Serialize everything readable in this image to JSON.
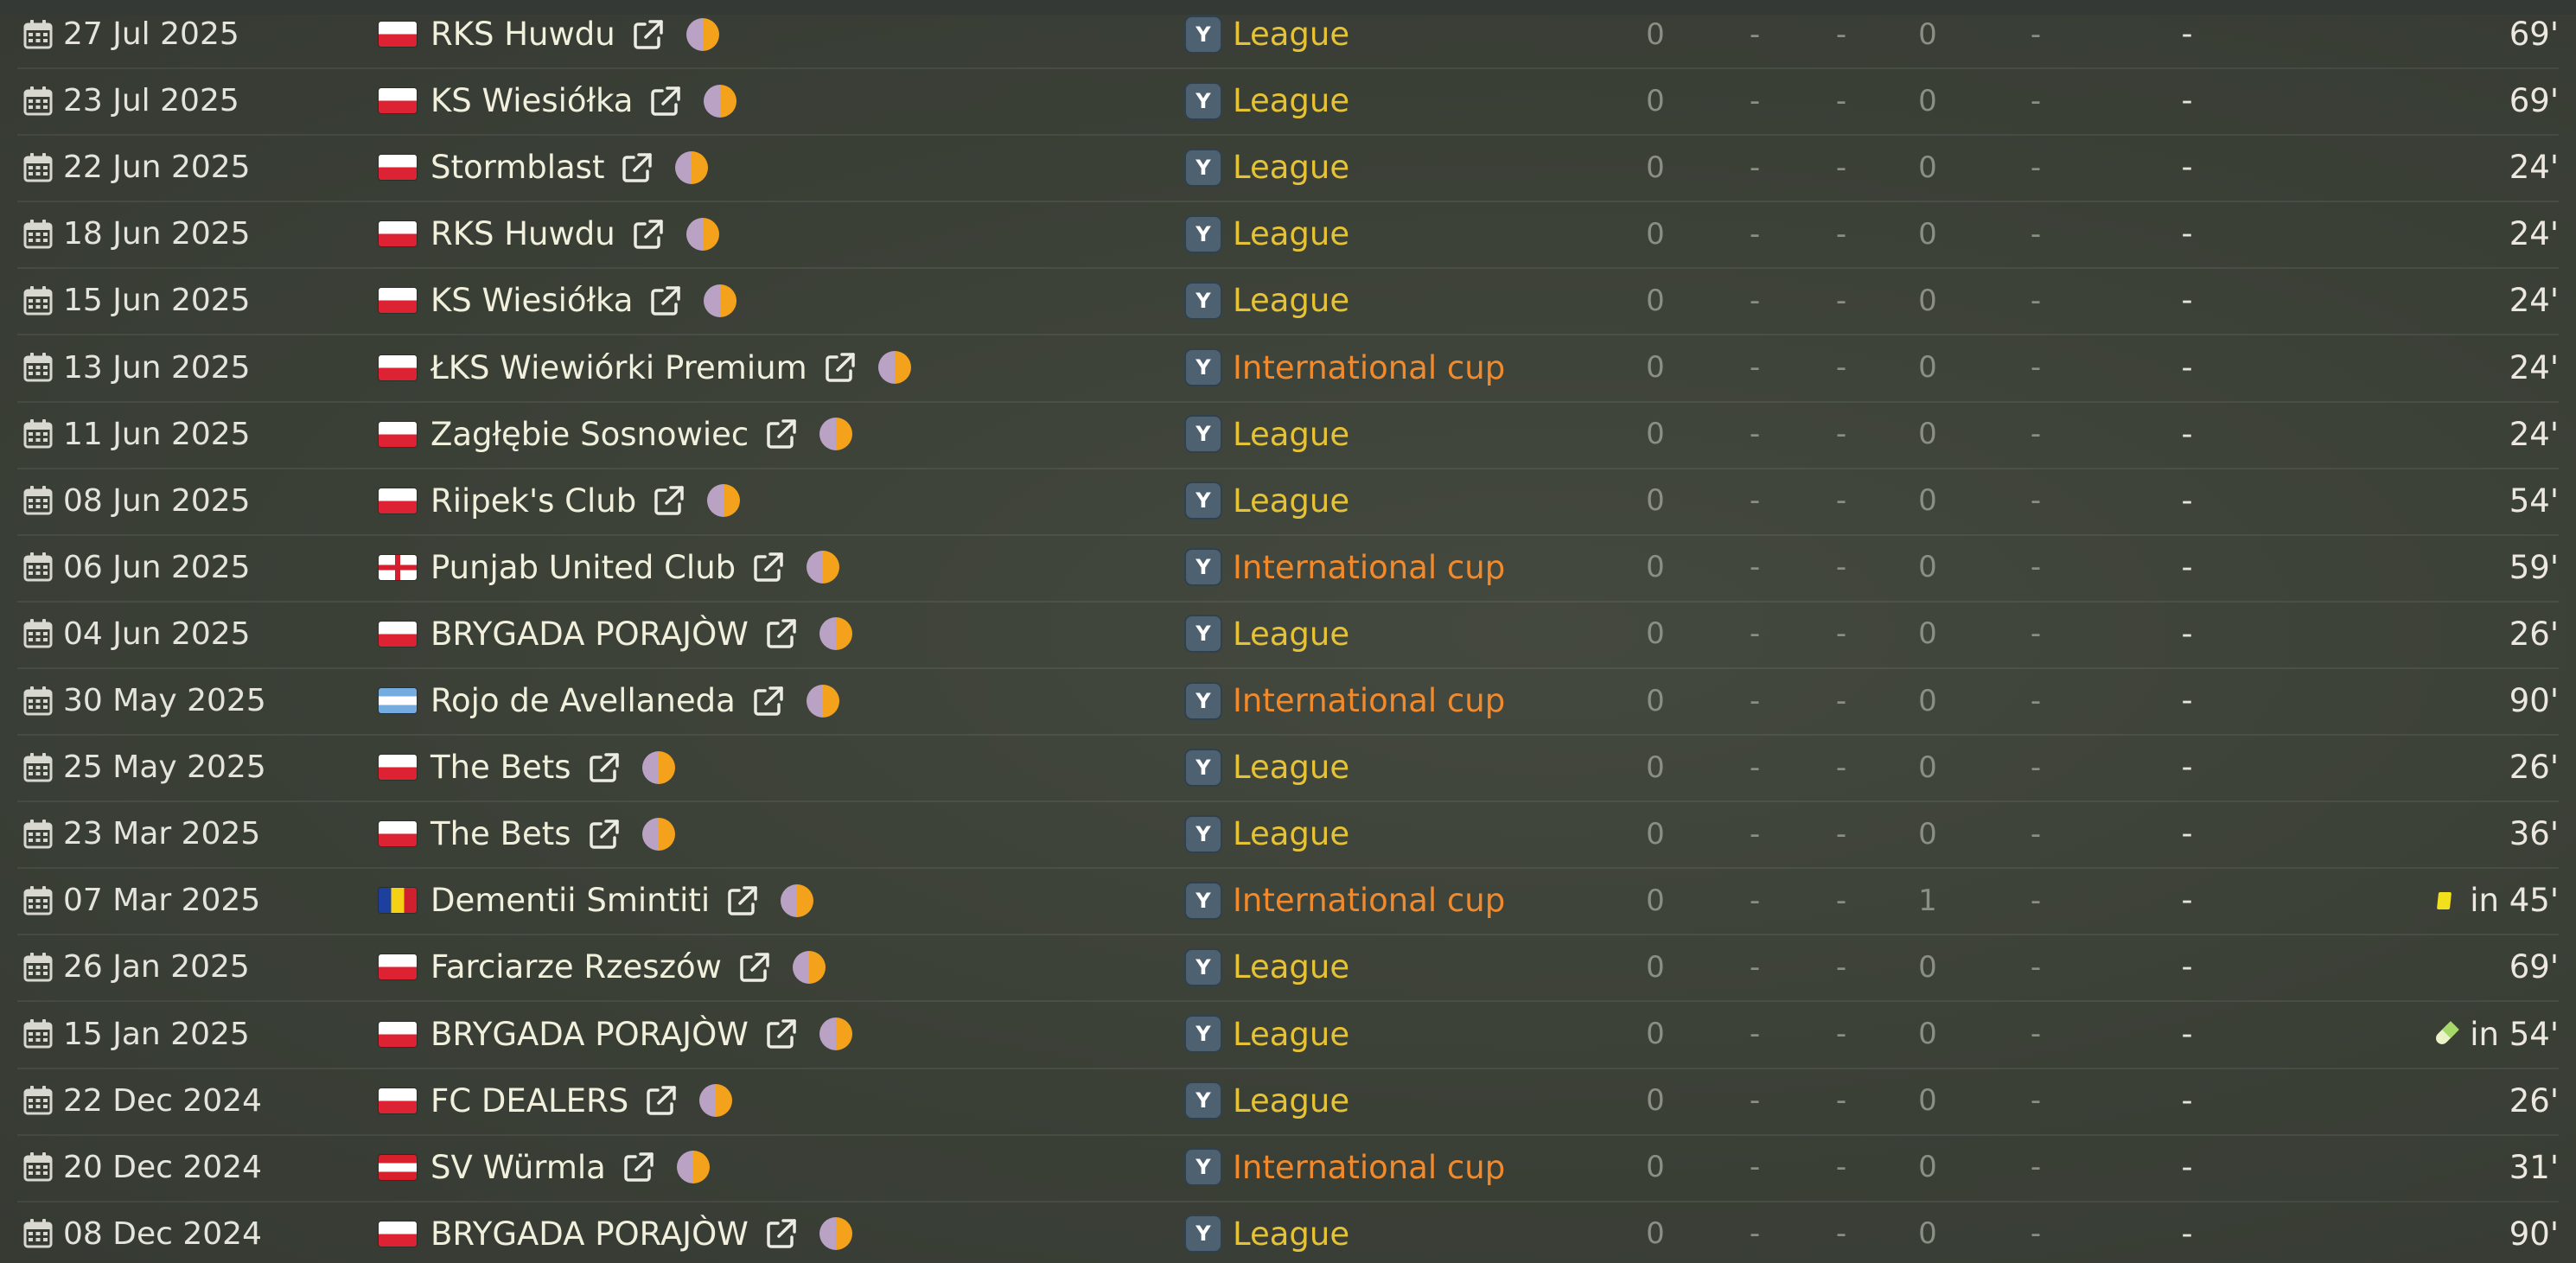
{
  "colors": {
    "league": "#e6c235",
    "international_cup": "#f08a2d",
    "background": "#3d4239"
  },
  "rows": [
    {
      "date": "27 Jul 2025",
      "flag": "poland",
      "club": "RKS Huwdu",
      "badge": "Y",
      "competition": "League",
      "comp_type": "league",
      "c1": "0",
      "c2": "-",
      "c3": "-",
      "c4": "0",
      "c5": "-",
      "c6": "-",
      "minutes": "69'",
      "event": ""
    },
    {
      "date": "23 Jul 2025",
      "flag": "poland",
      "club": "KS Wiesiółka",
      "badge": "Y",
      "competition": "League",
      "comp_type": "league",
      "c1": "0",
      "c2": "-",
      "c3": "-",
      "c4": "0",
      "c5": "-",
      "c6": "-",
      "minutes": "69'",
      "event": ""
    },
    {
      "date": "22 Jun 2025",
      "flag": "poland",
      "club": "Stormblast",
      "badge": "Y",
      "competition": "League",
      "comp_type": "league",
      "c1": "0",
      "c2": "-",
      "c3": "-",
      "c4": "0",
      "c5": "-",
      "c6": "-",
      "minutes": "24'",
      "event": ""
    },
    {
      "date": "18 Jun 2025",
      "flag": "poland",
      "club": "RKS Huwdu",
      "badge": "Y",
      "competition": "League",
      "comp_type": "league",
      "c1": "0",
      "c2": "-",
      "c3": "-",
      "c4": "0",
      "c5": "-",
      "c6": "-",
      "minutes": "24'",
      "event": ""
    },
    {
      "date": "15 Jun 2025",
      "flag": "poland",
      "club": "KS Wiesiółka",
      "badge": "Y",
      "competition": "League",
      "comp_type": "league",
      "c1": "0",
      "c2": "-",
      "c3": "-",
      "c4": "0",
      "c5": "-",
      "c6": "-",
      "minutes": "24'",
      "event": ""
    },
    {
      "date": "13 Jun 2025",
      "flag": "poland",
      "club": "ŁKS Wiewiórki Premium",
      "badge": "Y",
      "competition": "International cup",
      "comp_type": "cup",
      "c1": "0",
      "c2": "-",
      "c3": "-",
      "c4": "0",
      "c5": "-",
      "c6": "-",
      "minutes": "24'",
      "event": ""
    },
    {
      "date": "11 Jun 2025",
      "flag": "poland",
      "club": "Zagłębie Sosnowiec",
      "badge": "Y",
      "competition": "League",
      "comp_type": "league",
      "c1": "0",
      "c2": "-",
      "c3": "-",
      "c4": "0",
      "c5": "-",
      "c6": "-",
      "minutes": "24'",
      "event": ""
    },
    {
      "date": "08 Jun 2025",
      "flag": "poland",
      "club": "Riipek's Club",
      "badge": "Y",
      "competition": "League",
      "comp_type": "league",
      "c1": "0",
      "c2": "-",
      "c3": "-",
      "c4": "0",
      "c5": "-",
      "c6": "-",
      "minutes": "54'",
      "event": ""
    },
    {
      "date": "06 Jun 2025",
      "flag": "england",
      "club": "Punjab United Club",
      "badge": "Y",
      "competition": "International cup",
      "comp_type": "cup",
      "c1": "0",
      "c2": "-",
      "c3": "-",
      "c4": "0",
      "c5": "-",
      "c6": "-",
      "minutes": "59'",
      "event": ""
    },
    {
      "date": "04 Jun 2025",
      "flag": "poland",
      "club": "BRYGADA PORAJÒW",
      "badge": "Y",
      "competition": "League",
      "comp_type": "league",
      "c1": "0",
      "c2": "-",
      "c3": "-",
      "c4": "0",
      "c5": "-",
      "c6": "-",
      "minutes": "26'",
      "event": ""
    },
    {
      "date": "30 May 2025",
      "flag": "argentina",
      "club": "Rojo de Avellaneda",
      "badge": "Y",
      "competition": "International cup",
      "comp_type": "cup",
      "c1": "0",
      "c2": "-",
      "c3": "-",
      "c4": "0",
      "c5": "-",
      "c6": "-",
      "minutes": "90'",
      "event": ""
    },
    {
      "date": "25 May 2025",
      "flag": "poland",
      "club": "The Bets",
      "badge": "Y",
      "competition": "League",
      "comp_type": "league",
      "c1": "0",
      "c2": "-",
      "c3": "-",
      "c4": "0",
      "c5": "-",
      "c6": "-",
      "minutes": "26'",
      "event": ""
    },
    {
      "date": "23 Mar 2025",
      "flag": "poland",
      "club": "The Bets",
      "badge": "Y",
      "competition": "League",
      "comp_type": "league",
      "c1": "0",
      "c2": "-",
      "c3": "-",
      "c4": "0",
      "c5": "-",
      "c6": "-",
      "minutes": "36'",
      "event": ""
    },
    {
      "date": "07 Mar 2025",
      "flag": "romania",
      "club": "Dementii Smintiti",
      "badge": "Y",
      "competition": "International cup",
      "comp_type": "cup",
      "c1": "0",
      "c2": "-",
      "c3": "-",
      "c4": "1",
      "c5": "-",
      "c6": "-",
      "minutes": "in 45'",
      "event": "yellow-card"
    },
    {
      "date": "26 Jan 2025",
      "flag": "poland",
      "club": "Farciarze Rzeszów",
      "badge": "Y",
      "competition": "League",
      "comp_type": "league",
      "c1": "0",
      "c2": "-",
      "c3": "-",
      "c4": "0",
      "c5": "-",
      "c6": "-",
      "minutes": "69'",
      "event": ""
    },
    {
      "date": "15 Jan 2025",
      "flag": "poland",
      "club": "BRYGADA PORAJÒW",
      "badge": "Y",
      "competition": "League",
      "comp_type": "league",
      "c1": "0",
      "c2": "-",
      "c3": "-",
      "c4": "0",
      "c5": "-",
      "c6": "-",
      "minutes": "in 54'",
      "event": "injury-pill"
    },
    {
      "date": "22 Dec 2024",
      "flag": "poland",
      "club": "FC DEALERS",
      "badge": "Y",
      "competition": "League",
      "comp_type": "league",
      "c1": "0",
      "c2": "-",
      "c3": "-",
      "c4": "0",
      "c5": "-",
      "c6": "-",
      "minutes": "26'",
      "event": ""
    },
    {
      "date": "20 Dec 2024",
      "flag": "austria",
      "club": "SV Würmla",
      "badge": "Y",
      "competition": "International cup",
      "comp_type": "cup",
      "c1": "0",
      "c2": "-",
      "c3": "-",
      "c4": "0",
      "c5": "-",
      "c6": "-",
      "minutes": "31'",
      "event": ""
    },
    {
      "date": "08 Dec 2024",
      "flag": "poland",
      "club": "BRYGADA PORAJÒW",
      "badge": "Y",
      "competition": "League",
      "comp_type": "league",
      "c1": "0",
      "c2": "-",
      "c3": "-",
      "c4": "0",
      "c5": "-",
      "c6": "-",
      "minutes": "90'",
      "event": ""
    }
  ]
}
